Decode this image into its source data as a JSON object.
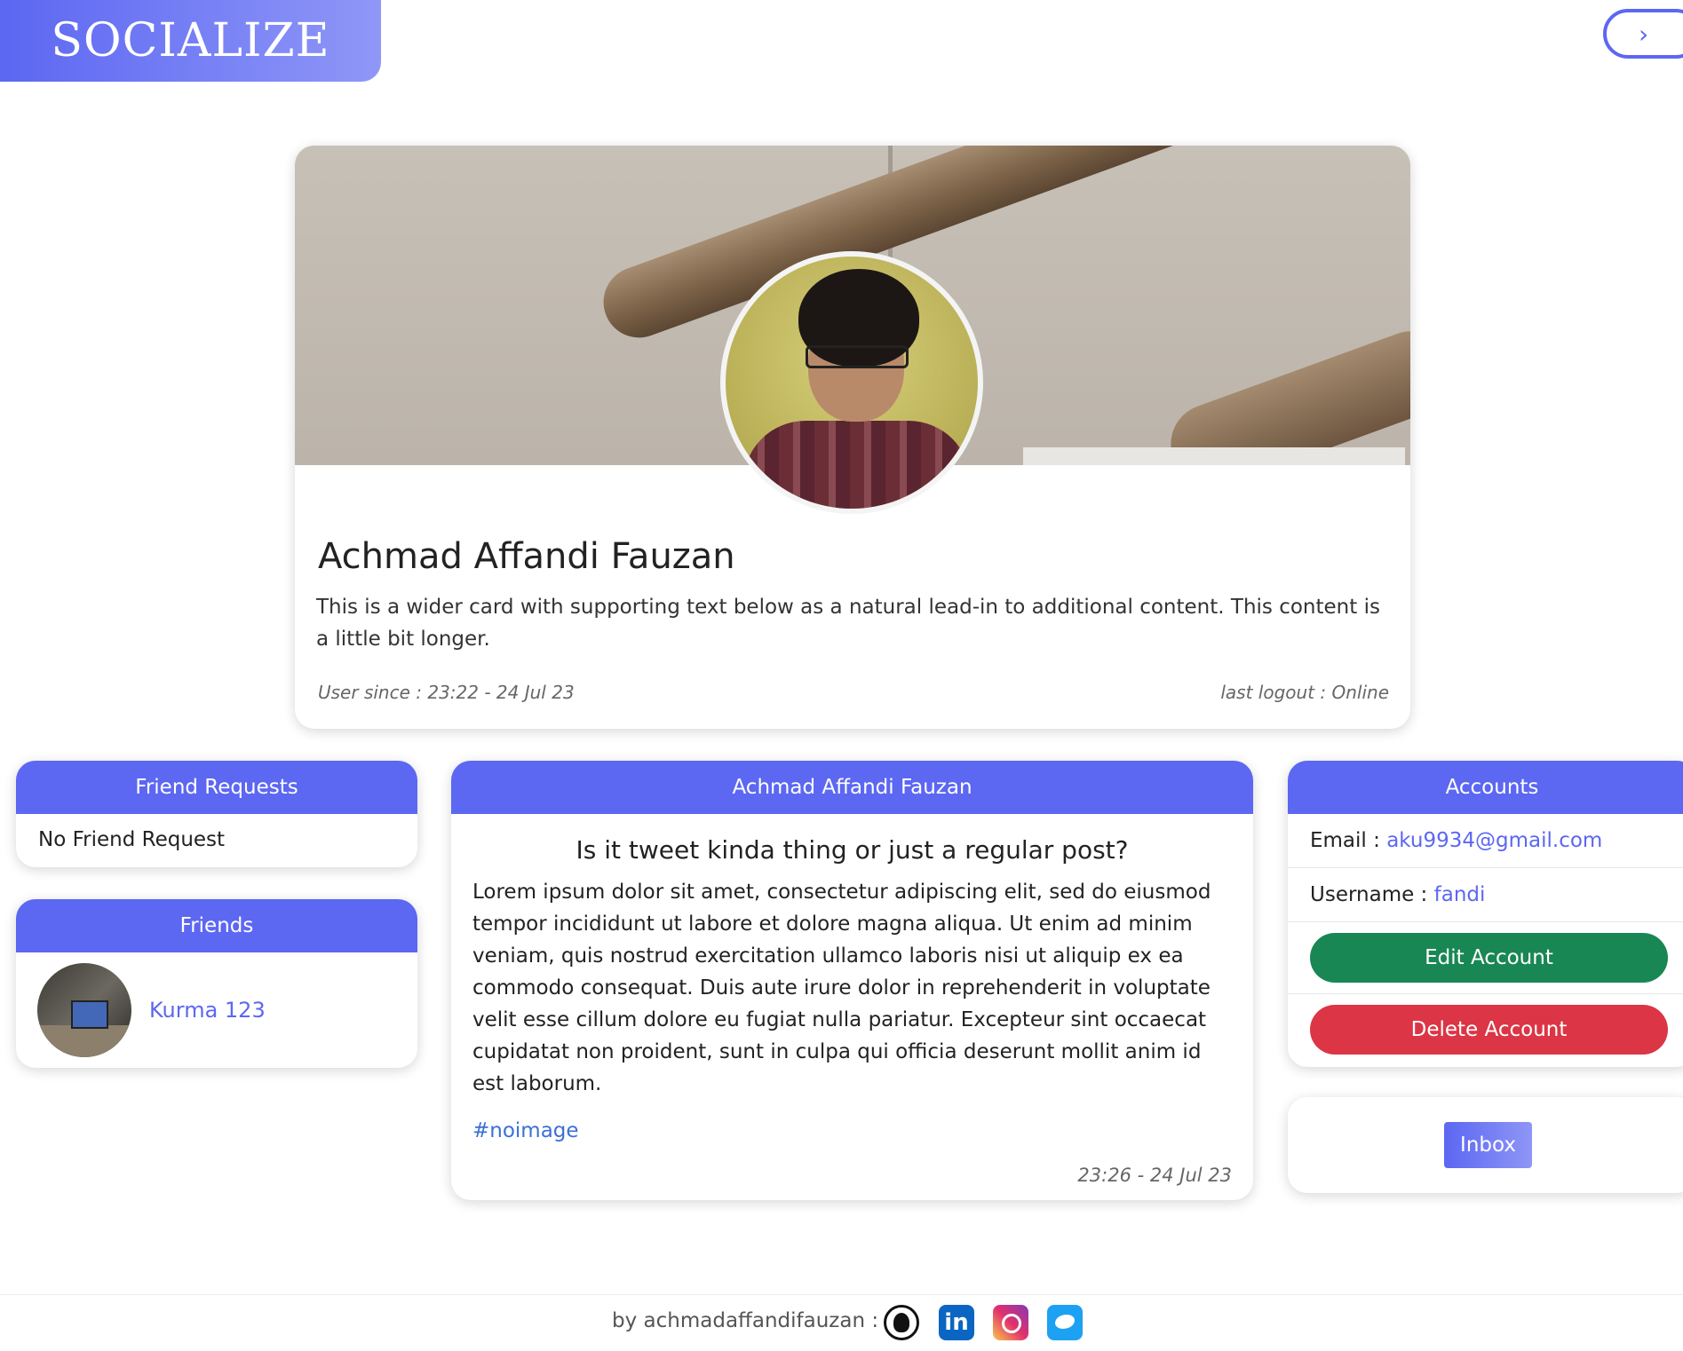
{
  "brand": {
    "logo": "SOCIALIZE"
  },
  "header": {
    "toggle_icon": "›"
  },
  "profile": {
    "name": "Achmad Affandi Fauzan",
    "bio": "This is a wider card with supporting text below as a natural lead-in to additional content. This content is a little bit longer.",
    "user_since": "User since : 23:22 - 24 Jul 23",
    "last_logout": "last logout : Online"
  },
  "friend_requests": {
    "title": "Friend Requests",
    "empty": "No Friend Request"
  },
  "friends": {
    "title": "Friends",
    "items": [
      {
        "name": "Kurma 123"
      }
    ]
  },
  "post": {
    "author": "Achmad Affandi Fauzan",
    "title": "Is it tweet kinda thing or just a regular post?",
    "body": "Lorem ipsum dolor sit amet, consectetur adipiscing elit, sed do eiusmod tempor incididunt ut labore et dolore magna aliqua. Ut enim ad minim veniam, quis nostrud exercitation ullamco laboris nisi ut aliquip ex ea commodo consequat. Duis aute irure dolor in reprehenderit in voluptate velit esse cillum dolore eu fugiat nulla pariatur. Excepteur sint occaecat cupidatat non proident, sunt in culpa qui officia deserunt mollit anim id est laborum.",
    "hashtag": "#noimage",
    "timestamp": "23:26 - 24 Jul 23"
  },
  "accounts": {
    "title": "Accounts",
    "email_label": "Email : ",
    "email": "aku9934@gmail.com",
    "username_label": "Username : ",
    "username": "fandi",
    "edit_label": "Edit Account",
    "delete_label": "Delete Account"
  },
  "inbox": {
    "label": "Inbox"
  },
  "footer": {
    "text": "by achmadaffandifauzan :",
    "linkedin_glyph": "in",
    "icons": [
      "github-icon",
      "linkedin-icon",
      "instagram-icon",
      "twitter-icon"
    ]
  },
  "colors": {
    "accent": "#5c67f2",
    "edit": "#198754",
    "delete": "#dc3545",
    "link": "#3b6fd8"
  }
}
